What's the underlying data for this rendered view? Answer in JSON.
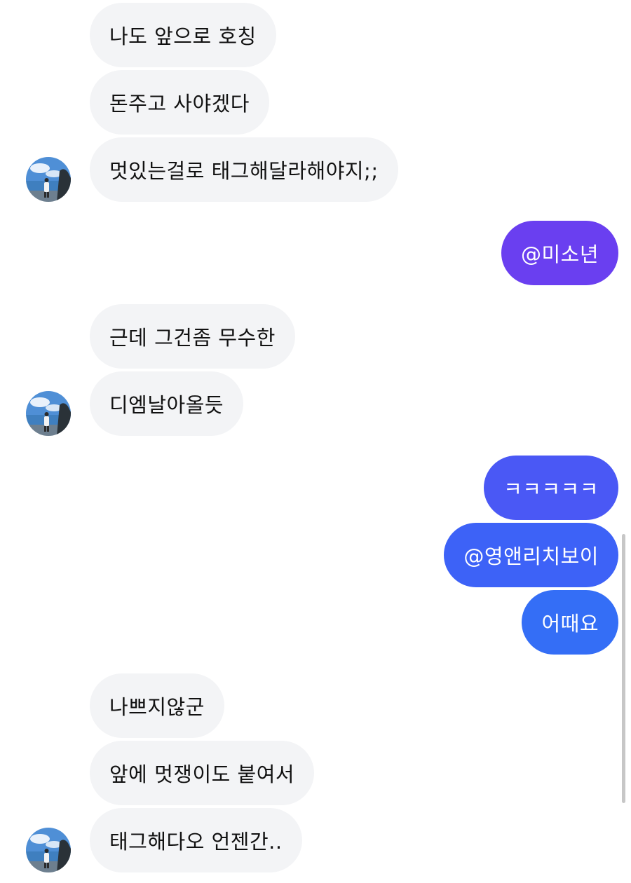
{
  "messages": [
    {
      "id": "m1",
      "side": "received",
      "text": "나도 앞으로 호칭"
    },
    {
      "id": "m2",
      "side": "received",
      "text": "돈주고 사야겠다"
    },
    {
      "id": "m3",
      "side": "received",
      "text": "멋있는걸로 태그해달라해야지;;",
      "avatar": true
    },
    {
      "id": "m4",
      "side": "sent",
      "text": "@미소년",
      "color": "#6a3ff0"
    },
    {
      "id": "m5",
      "side": "received",
      "text": "근데 그건좀 무수한"
    },
    {
      "id": "m6",
      "side": "received",
      "text": "디엠날아올듯",
      "avatar": true
    },
    {
      "id": "m7",
      "side": "sent",
      "text": "ㅋㅋㅋㅋㅋ",
      "color": "#4a58f5"
    },
    {
      "id": "m8",
      "side": "sent",
      "text": "@영앤리치보이",
      "color": "#3d62f7"
    },
    {
      "id": "m9",
      "side": "sent",
      "text": "어때요",
      "color": "#346ef6"
    },
    {
      "id": "m10",
      "side": "received",
      "text": "나쁘지않군"
    },
    {
      "id": "m11",
      "side": "received",
      "text": "앞에 멋쟁이도 붙여서"
    },
    {
      "id": "m12",
      "side": "received",
      "text": "태그해다오 언젠간..",
      "avatar": true
    }
  ],
  "theme": {
    "received_bubble": "#f3f4f6",
    "received_text": "#111111",
    "sent_text": "#ffffff"
  },
  "icons": {
    "avatar": "profile-photo-beach"
  }
}
